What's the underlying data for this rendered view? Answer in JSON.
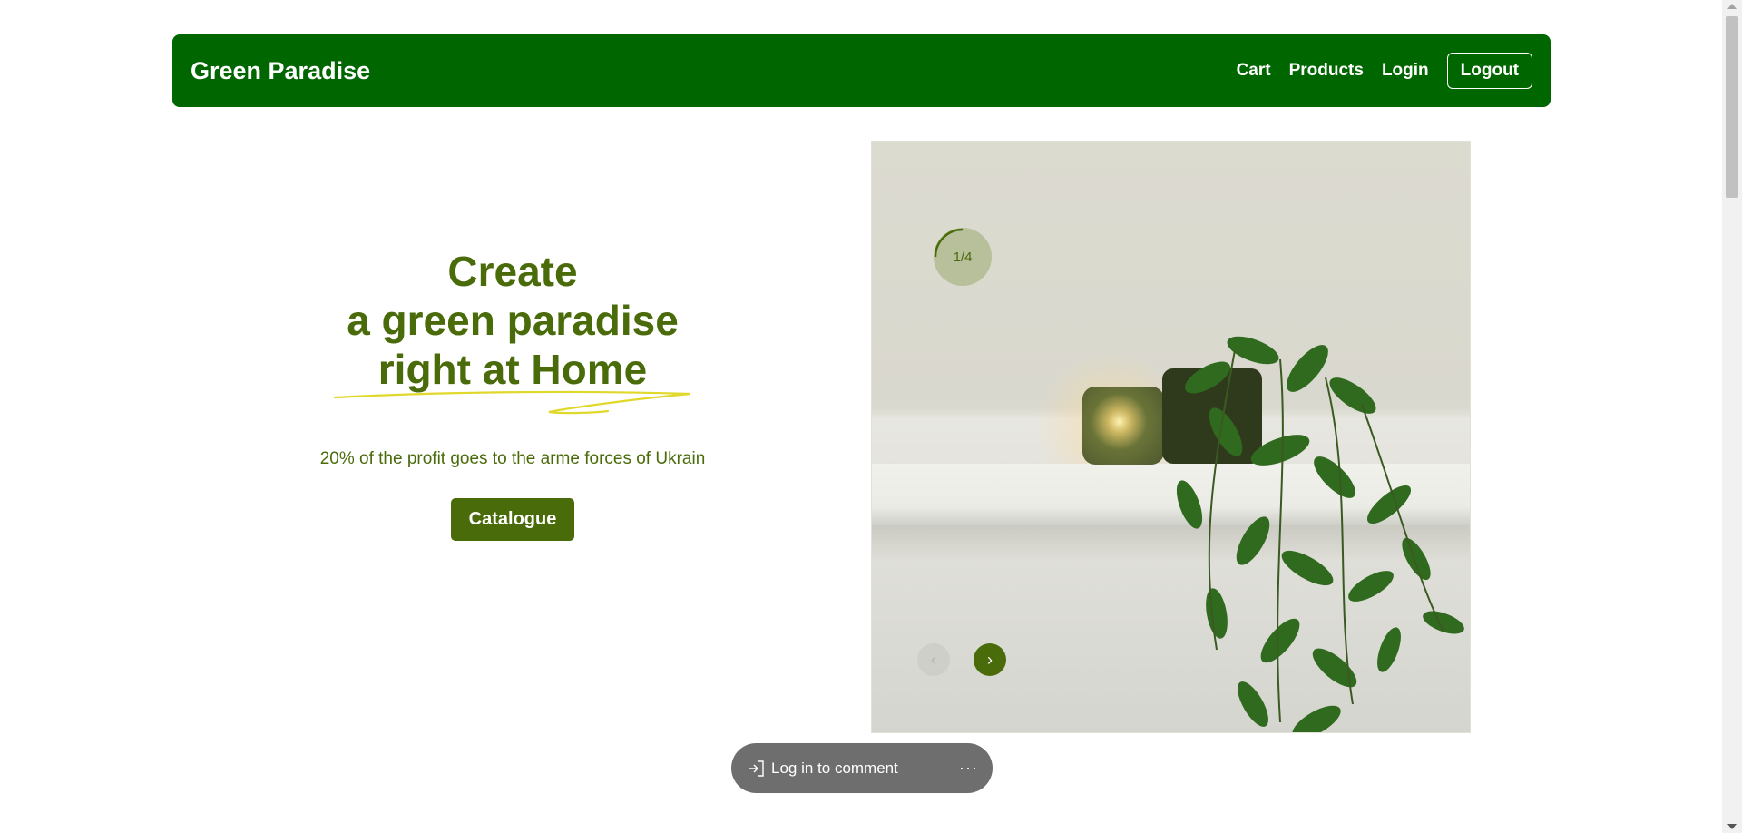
{
  "navbar": {
    "brand": "Green Paradise",
    "links": [
      "Cart",
      "Products",
      "Login"
    ],
    "logout_label": "Logout",
    "background": "#006600"
  },
  "hero": {
    "title_lines": [
      "Create",
      "a green paradise",
      "right at Home"
    ],
    "subtitle": "20% of the profit goes to the arme forces of Ukrain",
    "cta_label": "Catalogue",
    "accent_color": "#4a6b0a",
    "underline_color": "#e0d82a"
  },
  "slider": {
    "counter": "1/4",
    "current_slide": 1,
    "total_slides": 4,
    "prev_icon": "chevron-left-icon",
    "next_icon": "chevron-right-icon",
    "prev_glyph": "‹",
    "next_glyph": "›"
  },
  "comment_bar": {
    "label": "Log in to comment",
    "icon": "login-icon",
    "more": "···"
  }
}
